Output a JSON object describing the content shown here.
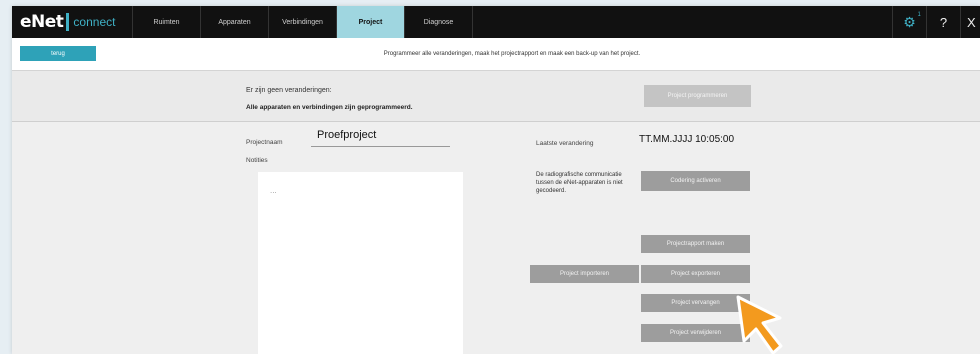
{
  "app": {
    "logo_text": "eNet",
    "logo_sub": "connect"
  },
  "nav": {
    "tabs": [
      {
        "label": "Ruimten"
      },
      {
        "label": "Apparaten"
      },
      {
        "label": "Verbindingen"
      },
      {
        "label": "Project",
        "active": true
      },
      {
        "label": "Diagnose"
      }
    ],
    "settings_badge": "1",
    "help_label": "?",
    "close_label": "X"
  },
  "subbar": {
    "back_label": "terug",
    "message": "Programmeer alle veranderingen, maak het projectrapport en maak een back-up van het project."
  },
  "status": {
    "line1": "Er zijn geen veranderingen:",
    "line2": "Alle apparaten en verbindingen zijn geprogrammeerd.",
    "program_button": "Project programmeren"
  },
  "project": {
    "name_label": "Projectnaam",
    "name_value": "Proefproject",
    "notes_label": "Notities",
    "notes_value": "..."
  },
  "info": {
    "last_change_label": "Laatste verandering",
    "last_change_value": "TT.MM.JJJJ 10:05:00",
    "radio_text": "De radiografische communicatie tussen de eNet-apparaten is niet gecodeerd.",
    "encrypt_button": "Codering activeren"
  },
  "actions": {
    "report_button": "Projectrapport maken",
    "import_button": "Project importeren",
    "export_button": "Project exporteren",
    "replace_button": "Project vervangen",
    "delete_button": "Project verwijderen"
  },
  "colors": {
    "accent": "#2ea2b8",
    "active_tab": "#9fd6e0",
    "cursor": "#f39a1e"
  }
}
